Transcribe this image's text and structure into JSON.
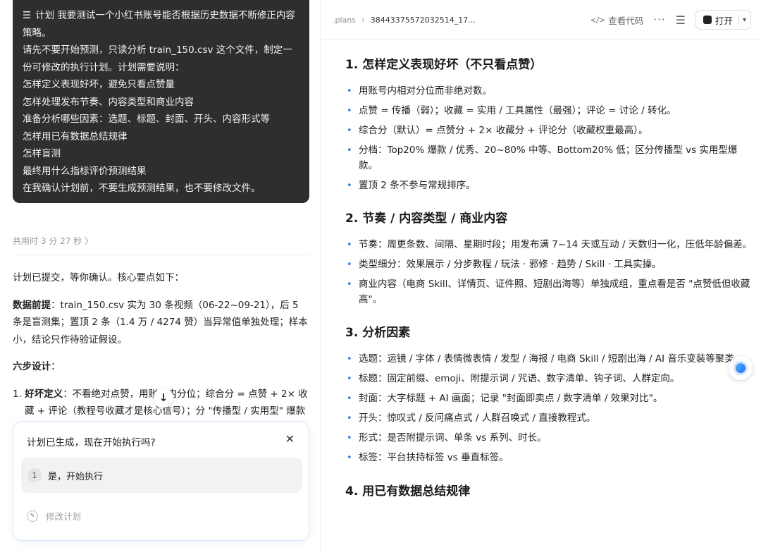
{
  "chat": {
    "prompt_lines": [
      "计划 我要测试一个小红书账号能否根据历史数据不断修正内容策略。",
      "请先不要开始预测，只读分析 train_150.csv 这个文件，制定一",
      "份可修改的执行计划。计划需要说明：",
      "怎样定义表现好坏，避免只看点赞量",
      "怎样处理发布节奏、内容类型和商业内容",
      "准备分析哪些因素：选题、标题、封面、开头、内容形式等",
      "怎样用已有数据总结规律",
      "怎样盲测",
      "最终用什么指标评价预测结果",
      "在我确认计划前，不要生成预测结果，也不要修改文件。"
    ],
    "plan_icon": "list-icon",
    "timing": "共用时 3 分 27 秒 〉",
    "reply_intro": "计划已提交，等你确认。核心要点如下：",
    "data_premise_label": "数据前提",
    "data_premise_text": "：train_150.csv 实为 30 条视频（06-22~09-21），后 5 条是盲测集；置顶 2 条（1.4 万 / 4274 赞）当异常值单独处理；样本小，结论只作待验证假设。",
    "six_steps_label": "六步设计",
    "six_steps_colon": "：",
    "step1_num": "1.",
    "step1_label": "好坏定义",
    "step1_text": "：不看绝对点赞，用账号内分位；综合分 = 点赞 + 2× 收藏 + 评论（教程号收藏才是核心信号）；分 \"传播型 / 实用型\" 爆款",
    "confirm": {
      "question": "计划已生成，现在开始执行吗?",
      "option1_num": "1",
      "option1_label": "是，开始执行",
      "option2_label": "修改计划"
    }
  },
  "topbar": {
    "crumb_dir": ".plans",
    "crumb_sep": "›",
    "crumb_file": "38443375572032514_17...",
    "view_code": "查看代码",
    "more": "···",
    "open_label": "打开"
  },
  "doc": {
    "sections": [
      {
        "title": "1. 怎样定义表现好坏（不只看点赞）",
        "bullets": [
          "用账号内相对分位而非绝对数。",
          "点赞 = 传播（弱）；收藏 = 实用 / 工具属性（最强）；评论 = 讨论 / 转化。",
          "综合分（默认）= 点赞分 + 2× 收藏分 + 评论分（收藏权重最高）。",
          "分档：Top20% 爆款 / 优秀、20~80% 中等、Bottom20% 低；区分传播型 vs 实用型爆款。",
          "置顶 2 条不参与常规排序。"
        ]
      },
      {
        "title": "2. 节奏 / 内容类型 / 商业内容",
        "bullets": [
          "节奏：周更条数、间隔、星期时段；用发布满 7~14 天或互动 / 天数归一化，压低年龄偏差。",
          "类型细分：效果展示 / 分步教程 / 玩法 · 邪修 · 趋势 / Skill · 工具实操。",
          "商业内容（电商 Skill、详情页、证件照、短剧出海等）单独成组，重点看是否 \"点赞低但收藏高\"。"
        ]
      },
      {
        "title": "3. 分析因素",
        "bullets": [
          "选题：运镜 / 字体 / 表情微表情 / 发型 / 海报 / 电商 Skill / 短剧出海 / AI 音乐变装等聚类。",
          "标题：固定前缀、emoji、附提示词 / 咒语、数字清单、钩子词、人群定向。",
          "封面：大字标题 + AI 画面；记录 \"封面即卖点 / 数字清单 / 效果对比\"。",
          "开头：惊叹式 / 反问痛点式 / 人群召唤式 / 直接教程式。",
          "形式：是否附提示词、单条 vs 系列、时长。",
          "标签：平台扶持标签 vs 垂直标签。"
        ]
      },
      {
        "title": "4. 用已有数据总结规律",
        "bullets": []
      }
    ]
  },
  "colors": {
    "bubble_bg": "#2e2e2e",
    "bullet": "#3a7be0",
    "card_border": "#dbe7fb"
  }
}
